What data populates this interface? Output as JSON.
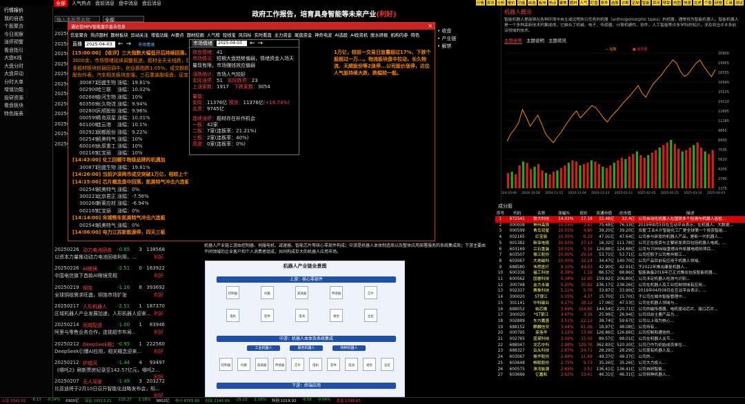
{
  "topbar": {
    "tabs": [
      "全部",
      "人气热点",
      "盘前消息",
      "盘中消息",
      "盘后消息"
    ],
    "active": 0,
    "right_menu": [
      "行情",
      "资讯",
      "分析",
      "报价",
      "功能",
      "自选",
      "板块",
      "热点",
      "聚焦",
      "题材",
      "人气",
      "盯盘",
      "条件",
      "选股",
      "诊断",
      "定制",
      "智能",
      "资讯",
      "帮助",
      "热图",
      "快速",
      "龙虎",
      "个股",
      "研报",
      "工具",
      "测试"
    ]
  },
  "leftnav": [
    "行情报价",
    "我的自选",
    "个股聚合",
    "今日观察",
    "涨停预警",
    "看盘指引",
    "大盘K线",
    "大盘分时",
    "大盘异动",
    "分时大单",
    "增值功能",
    "投研资源",
    "看盘板块",
    "特色报表"
  ],
  "search": {
    "placeholder": "输入本股票名称",
    "select": "全部"
  },
  "headline": {
    "text": "政府工作报告，培育具身智能等未来产业",
    "tag": "(利好)"
  },
  "news_bottom": [
    {
      "date": "20250226",
      "name": "动力电池回收",
      "pct": "-0.85",
      "n1": "3",
      "n2": "138568",
      "text": "以资本力量推动动力电池回收利用，...",
      "tag": "利好"
    },
    {
      "date": "20250226",
      "name": "AI眼镜",
      "pct": "-2.51",
      "n1": "0",
      "n2": "163922",
      "text": "中国电信旗下首款AI眼镜亮相",
      "tag": "利好"
    },
    {
      "date": "20250219",
      "name": "铜箔",
      "pct": "-1.16",
      "n1": "8",
      "n2": "393692",
      "text": "全球铜缆需求旺盛，铜箔市场扩张",
      "tag": "利好"
    },
    {
      "date": "20250217",
      "name": "人形机器人",
      "pct": "-2.51",
      "n1": "1",
      "n2": "187370",
      "text": "区域机器人产业发展加速，人形机器人迎来...",
      "tag": "利好"
    },
    {
      "date": "20250214",
      "name": "同城配送",
      "pct": "-1.00",
      "n1": "1",
      "n2": "83946",
      "text": "阿里与零售业务合作，连锁超市布局..",
      "tag": "利好"
    },
    {
      "date": "20250212",
      "name": "DeepSeek概念",
      "pct": "-0.95",
      "n1": "1",
      "n2": "222560",
      "text": "DeepSeek引爆AI应用，相关概念迎来...",
      "tag": "利好"
    },
    {
      "date": "20250212",
      "name": "护城河",
      "pct": "-1.44",
      "n1": "4",
      "n2": "93497",
      "text": "《哪吒2》刷新票房纪录至142.57亿元，哪吒2...",
      "tag": "利好"
    },
    {
      "date": "20250207",
      "name": "无人驾驶",
      "pct": "-1.49",
      "n1": "3",
      "n2": "203272",
      "text": "比亚迪将于2月10日召开智能化战略发布会，标...",
      "tag": "利好"
    },
    {
      "date": "20250120",
      "name": "芯片",
      "pct": "-1.00",
      "n1": "1",
      "n2": "664177",
      "text": "",
      "tag": ""
    }
  ],
  "news_left_top": [
    {
      "date": "2025030",
      "text": ""
    },
    {
      "date": "2025030",
      "text": "上海..."
    },
    {
      "date": "2025030",
      "text": "多地出..."
    },
    {
      "date": "2025030",
      "text": "DeepS..."
    },
    {
      "date": "2025030",
      "text": "可控核..."
    },
    {
      "date": "2025030",
      "text": "比亚..."
    },
    {
      "date": "2025030",
      "text": "人工..."
    },
    {
      "date": "2025030",
      "text": "央视..."
    },
    {
      "date": "2025030",
      "text": "华为江..."
    },
    {
      "date": "2025030",
      "text": "中国..."
    },
    {
      "date": "2025030",
      "text": "RISC-V..."
    },
    {
      "date": "2025030",
      "text": "双重..."
    }
  ],
  "dialog": {
    "title": "通达信MPV智能盘中直击信息",
    "close": "×",
    "tabs": [
      "信息聚合",
      "热点题材",
      "题材板块",
      "异动关注",
      "增值功能",
      "AI要点",
      "题材挖掘",
      "人气榜",
      "短线宝",
      "风向标",
      "实时看盘",
      "主力资金",
      "尾盘资金",
      "神奇电波",
      "AI选股",
      "AI投资机",
      "脱水研报",
      "机构内参",
      "特色"
    ],
    "date_label": "直播",
    "date": "2025-04-03",
    "link": "市场情绪",
    "feed": [
      {
        "h": "[15:00:00] 【收评】三大指数大幅低开后持续回落，全天...",
        "cls": "h"
      },
      {
        "h": "3000余，市场情绪延续调整低迷，题材全天全线跌，医药...",
        "cls": "h2"
      },
      {
        "h": "多题材板块较弱回调中，创业板指跌1.05%，成交额超...",
        "cls": "h2"
      },
      {
        "h": "股份作表。汽车相关板块走强，三石重装股吸盘，证宝...",
        "cls": "h2"
      },
      {
        "r": [
          "300871",
          "回盛生物",
          "涨幅：19.81%"
        ]
      },
      {
        "r": [
          "002900",
          "哈三联",
          "涨幅：10.02%"
        ]
      },
      {
        "r": [
          "002688",
          "金河生物",
          "涨幅：10%"
        ]
      },
      {
        "r": [
          "603569",
          "长久物流",
          "涨幅：9.94%"
        ]
      },
      {
        "r": [
          "002800",
          "天顺股份",
          "涨幅：9.96%"
        ]
      },
      {
        "r": [
          "000599",
          "青岛双星",
          "涨幅：10.01%"
        ]
      },
      {
        "r": [
          "601008",
          "连云港",
          "涨幅：10.1%"
        ]
      },
      {
        "r": [
          "002923",
          "润都股份",
          "涨幅：9.22%"
        ]
      },
      {
        "r": [
          "002549",
          "凯美特气",
          "涨幅：10%"
        ]
      },
      {
        "r": [
          "600169",
          "太原重工",
          "涨幅：10%"
        ]
      },
      {
        "r": [
          "002165",
          "红宝丽",
          "涨幅：10%"
        ]
      },
      {
        "h": "[14:43:00] 化工回暖牛物级品牌的机遇加",
        "cls": "h"
      },
      {
        "r": [
          "300871",
          "回盛生物",
          "涨幅：19.81%"
        ]
      },
      {
        "h": "[14:26:00] 当前沪深两市成交突破1万亿，相较上个交易",
        "cls": "h"
      },
      {
        "h": "[14:15:00] 芯片概念盘中回落，凯美特气冲击六连板，S",
        "cls": "h"
      },
      {
        "r": [
          "002549",
          "凯美特气",
          "涨幅：0%"
        ]
      },
      {
        "r": [
          "300223",
          "北京君正",
          "涨幅：-7.56%"
        ]
      },
      {
        "r": [
          "300260",
          "新莱应材",
          "涨幅：-6.94%"
        ]
      },
      {
        "r": [
          "002165",
          "红宝丽",
          "涨幅：0%"
        ]
      },
      {
        "h": "[14:14:00] 宋城畅车凯美特气冲击六连板",
        "cls": "h"
      },
      {
        "r": [
          "002549",
          "凯美特气",
          "涨幅：0%"
        ]
      },
      {
        "h": "[14:06:00] 电力江苏新能源停，四天三板",
        "cls": "h"
      }
    ],
    "right_text": "1万亿，较前一交易日放量超过17%，下跌个股超过一万...。物流板块盘中拉动，长久物流、天顺股份等2涨停...公司股价涨停，达位人气股持续大跌，跌幅较一般。"
  },
  "market": {
    "title": "市场情绪",
    "date": "2025-04-03",
    "overall_label": "综合情绪：",
    "overall": "41",
    "summary_label": "市场情况：",
    "summary": "短期大盘趋势偏弱，情绪资金入场天量现有限，市场赚钱效应偏弱",
    "stat_label": "涨跌统计：",
    "stat": "市场人气较好",
    "limit_up_label": "实际涨停：",
    "limit_up": "51",
    "limit_down_label": "实际跌停：",
    "limit_down": "23",
    "up_label": "上涨家数：",
    "up": "1917",
    "down_label": "下跌家数：",
    "down": "3054",
    "amount_header": "量能：",
    "amount_label": "实际：",
    "amount": "11376亿",
    "forecast_label": "预测：",
    "forecast": "11376亿",
    "forecast_chg": "(+16.74%)",
    "north_label": "北资：",
    "north": "9745亿",
    "board_header": "连续涨停：",
    "board_text": "题材存在补作机会",
    "boards": [
      {
        "label": "一板：",
        "value": "42家"
      },
      {
        "label": "二板：",
        "value": "7家(连板率：21.21%)"
      },
      {
        "label": "三板：",
        "value": "2家(连板率：40%)"
      },
      {
        "label": "高度：",
        "value": "0家(连板率：0%)"
      }
    ]
  },
  "right_menu": [
    "收盘",
    "产业链",
    "解禁"
  ],
  "concept": {
    "title": "机器人概念",
    "desc": "智能机器人是能够在各种环境中自主或远程执行任务的机器（anthropomorphic tasks）的机器，通常将为智能机器人。智能机器人是一个多种高新技术的集成体，它融合了机械、电子、传感器、计算机硬件、软件、人工智能等许多学科的知识，涉及到当今许多前沿领域的技术。",
    "tabs": [
      "主题走势",
      "主题说明",
      "主题资讯"
    ]
  },
  "chart_data": {
    "type": "line",
    "title": "",
    "series": [
      {
        "name": "指数",
        "values": [
          1340,
          1450,
          1520,
          1610,
          1800,
          1690,
          1560,
          1640,
          1720,
          1590,
          1450,
          1380,
          1320,
          1400,
          1470,
          1560,
          1640,
          1720,
          1780,
          1680,
          1740,
          1800,
          1860,
          1830,
          1760,
          1680,
          1620,
          1700,
          1760,
          1820,
          1890,
          1950,
          2010,
          2080,
          2150,
          2040,
          1980,
          2090,
          2180,
          2240,
          2300,
          2380,
          2450,
          2520,
          2470,
          2350,
          2280,
          2320,
          2400,
          2470,
          2520,
          2430,
          2350,
          2280,
          2380
        ]
      },
      {
        "name": "成交额",
        "values": [
          120,
          130,
          110,
          180,
          210,
          200,
          150,
          170,
          190,
          140,
          120,
          110,
          130,
          140,
          160,
          180,
          200,
          220,
          210,
          180,
          190,
          200,
          220,
          210,
          190,
          170,
          160,
          180,
          200,
          220,
          240,
          230,
          250,
          270,
          290,
          260,
          240,
          260,
          280,
          300,
          320,
          340,
          360,
          380,
          350,
          310,
          290,
          300,
          320,
          340,
          360,
          320,
          290,
          270,
          300
        ]
      }
    ],
    "y_ticks": [
      "20800",
      "19955",
      "18355",
      "16940",
      "15525",
      "14110",
      "12695",
      "11280",
      "9865",
      "8450",
      "7035",
      "5620",
      "4205",
      "2790",
      "1375"
    ],
    "x_ticks": [
      "2024-10-08",
      "2024-10-28",
      "2024-11-15",
      "2024-12-04",
      "2024-12-23",
      "2025-01-13",
      "2025-02-05",
      "2025-02-25",
      "2025-03-14",
      "2025-04-03"
    ],
    "legend": [
      "指数",
      "成交额"
    ]
  },
  "stock_table": {
    "caption": "成分股",
    "headers": [
      "序号",
      "代码",
      "名称",
      "涨幅%",
      "现价",
      "流通市值",
      "总市值",
      "描述"
    ],
    "rows": [
      [
        "1",
        "872541",
        "铁大科技",
        "14.01%",
        "17.19",
        "15.48亿",
        "22.4亿",
        "公司自动化机器人在国铁多个检测与机器人巡检..."
      ],
      [
        "2",
        "000008",
        "神州高铁",
        "10.29%",
        "2.81",
        "75.48亿",
        "76.33亿",
        "2019年8月5日在互动平台表示，在机器人、大数据..."
      ],
      [
        "3",
        "000599",
        "青岛双星",
        "10.01%",
        "4.80",
        "39.20亿",
        "39.20亿",
        "双星'工业4.0'智能化工厂是全球第一个投资智能..."
      ],
      [
        "4",
        "002165",
        "红宝丽",
        "10.05%",
        "6.29",
        "47.01亿",
        "47.64亿",
        "公司参与研发的机器人产品，是新一代机器人..."
      ],
      [
        "5",
        "001382",
        "新亚电缆",
        "10.02%",
        "27.13",
        "16.32亿",
        "111.78亿",
        "公司正在投资与主要研发项目包括机器人电缆、..."
      ],
      [
        "6",
        "603169",
        "兰石重装",
        "10.01%",
        "5.16",
        "124.88亿",
        "124.88亿",
        "公司与70MW级重燃合作拓展电缆的项目..."
      ],
      [
        "7",
        "603507",
        "振江股份",
        "10.00%",
        "29.14",
        "53.71亿",
        "53.71亿",
        "公司控股子公司常州振江..."
      ],
      [
        "8",
        "603067",
        "大地磁科",
        "10.00%",
        "32.24",
        "34.47亿",
        "140.70亿",
        "公司产品目前有应用于机器人领域。"
      ],
      [
        "9",
        "688580",
        "伟思医疗",
        "9.10%",
        "44.03",
        "42.90亿",
        "42.91亿",
        "于2022年推出康复机器人..."
      ],
      [
        "10",
        "600336",
        "福工科技",
        "6.38%",
        "1.19",
        "86.57亿",
        "98.86亿",
        "智能装备2016年已正式推出包括智能机器..."
      ],
      [
        "11",
        "600562",
        "国睿科技",
        "5.38%",
        "12.80",
        "159.92亿",
        "206.80亿",
        "公司涉足机器人检测与识别..."
      ],
      [
        "12",
        "300748",
        "金力永磁",
        "5.20%",
        "30.82",
        "236.17亿",
        "238.26亿",
        "公司在机器人及工业控制领域有应用..."
      ],
      [
        "13",
        "002337",
        "赛象科技",
        "5.11%",
        "5.78",
        "33.87亿",
        "33.90亿",
        "2019年04月09日在互动平台表示，..."
      ],
      [
        "14",
        "300020",
        "ST银江",
        "5.05%",
        "4.37",
        "15.70亿",
        "15.70亿",
        "子公司在城市智能管理中..."
      ],
      [
        "15",
        "301141",
        "中科磁业",
        "4.27%",
        "38.12",
        "17.06亿",
        "47.53亿",
        "公司在机器人领域与..."
      ],
      [
        "16",
        "688052",
        "纳芯微",
        "3.69%",
        "154.85",
        "144.54亿",
        "220.71亿",
        "公司的磁传感器、电机驱动芯片、接口芯片..."
      ],
      [
        "17",
        "300020",
        "*ST银江",
        "3.67%",
        "3.36",
        "25.99亿",
        "26.94亿",
        "公司目前主要产品为..."
      ],
      [
        "18",
        "002889",
        "东方嘉盛",
        "3.51%",
        "22.12",
        "38.74亿",
        "59.67亿",
        "公司以上海为核心..."
      ],
      [
        "19",
        "688152",
        "麒麟信安",
        "3.44%",
        "61.06",
        "18.97亿",
        "48.08亿",
        "公司持有..."
      ],
      [
        "20",
        "000795",
        "英洛华",
        "3.22%",
        "13.96",
        "126.86亿",
        "126.86亿",
        "公司控制和通信的..."
      ],
      [
        "21",
        "002765",
        "蓝黛科技",
        "3.09%",
        "15.03",
        "89.57亿",
        "98.01亿",
        "公司在机器人关节..."
      ],
      [
        "22",
        "688047",
        "龙芯中科",
        "2.98%",
        "129.76",
        "362.83亿",
        "520.30亿",
        "公司已作为初始成员单位..."
      ],
      [
        "23",
        "688327",
        "云从科技",
        "2.87%",
        "24.71",
        "28.29亿",
        "28.29亿",
        "公司现有机器人及..."
      ],
      [
        "24",
        "603067",
        "振华股份",
        "2.68%",
        "11.49",
        "49.37亿",
        "49.37亿",
        "公司的..."
      ],
      [
        "25",
        "603648",
        "畅联股份",
        "2.75%",
        "9.73",
        "35.26亿",
        "35.26亿",
        "公司大力投入..."
      ],
      [
        "26",
        "600575",
        "淮河能源",
        "2.69%",
        "3.51",
        "136.41亿",
        "136.41亿",
        "公司自研智能..."
      ],
      [
        "27",
        "603666",
        "亿嘉和",
        "2.62%",
        "33.41",
        "46.31亿",
        "46.31亿",
        "公司特种机器人..."
      ]
    ]
  },
  "midtext": "机器人产业链上游由控制器、伺服电机、减速器、智能芯片等核心零部件构成；中游是机器人本体制造商以及整体应用部署服务的系统集成商；下游主要由不同领域的企业客户和个人消费者组成，共同构成巨大的机器人应用市场。",
  "industry_map": {
    "title": "机器人产业链全景图",
    "up": "上游：核心零部件",
    "mid": "中游：机器人本体及系统集成",
    "down": "下游：终端应用",
    "mid_tabs": [
      "工业机器人",
      "服务机器人",
      "特种机器人"
    ],
    "cells": [
      "控制器",
      "伺服",
      "减速器",
      "传感器",
      "芯片",
      "电机",
      "软件",
      "电池",
      "视觉",
      "丝杠"
    ]
  },
  "status": [
    {
      "t": "上证 3342.01",
      "c": "r"
    },
    {
      "t": "-8.12",
      "c": "g"
    },
    {
      "t": "-0.24%",
      "c": "g"
    },
    {
      "t": "6905亿",
      "c": "w"
    },
    {
      "t": "深证 10513.21",
      "c": "g"
    },
    {
      "t": "-125.27",
      "c": "g"
    },
    {
      "t": "-1.18%",
      "c": "g"
    },
    {
      "t": "9802亿",
      "c": "w"
    },
    {
      "t": "中小 6705.60",
      "c": "g"
    },
    {
      "t": "创业 2146.89",
      "c": "g"
    },
    {
      "t": "-25.22",
      "c": "g"
    },
    {
      "t": "-1.16%",
      "c": "g"
    },
    {
      "t": "科创 1018.92",
      "c": "w"
    },
    {
      "t": "-6.58",
      "c": "g"
    },
    {
      "t": "-0.64%",
      "c": "g"
    },
    {
      "t": "北证 1298.65",
      "c": "r"
    }
  ]
}
